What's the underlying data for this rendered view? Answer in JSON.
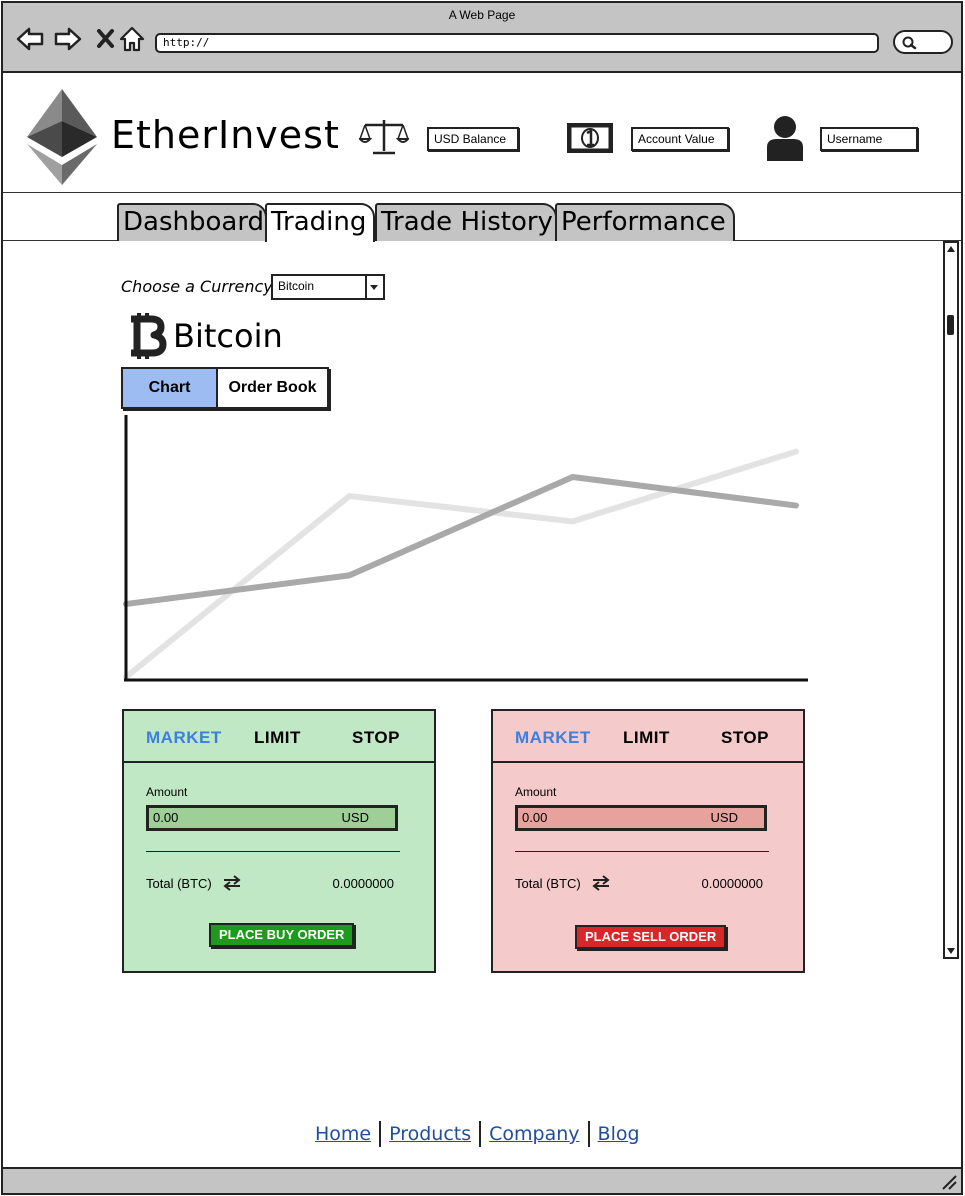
{
  "browser": {
    "title": "A Web Page",
    "url": "http://"
  },
  "header": {
    "brand": "EtherInvest",
    "usd_balance": "USD Balance",
    "account_value": "Account Value",
    "username": "Username"
  },
  "tabs": [
    {
      "label": "Dashboard"
    },
    {
      "label": "Trading"
    },
    {
      "label": "Trade History"
    },
    {
      "label": "Performance"
    }
  ],
  "currency": {
    "choose_label": "Choose a Currency",
    "selected": "Bitcoin",
    "title": "Bitcoin"
  },
  "view_toggle": {
    "chart": "Chart",
    "order_book": "Order Book",
    "active": "Chart"
  },
  "chart_data": {
    "type": "line",
    "x": [
      0,
      1,
      2,
      3
    ],
    "series": [
      {
        "values": [
          2.3,
          3.2,
          6.3,
          5.4
        ],
        "color": "#a9a9a9"
      },
      {
        "values": [
          0.0,
          5.7,
          4.9,
          7.1
        ],
        "color": "#e3e3e3"
      }
    ],
    "ylim": [
      0,
      8
    ],
    "title": "",
    "xlabel": "",
    "ylabel": ""
  },
  "buy_panel": {
    "tabs": [
      "MARKET",
      "LIMIT",
      "STOP"
    ],
    "active_tab": "MARKET",
    "amount_label": "Amount",
    "amount_value": "0.00",
    "amount_unit": "USD",
    "total_label": "Total (BTC)",
    "total_value": "0.0000000",
    "button": "PLACE BUY ORDER"
  },
  "sell_panel": {
    "tabs": [
      "MARKET",
      "LIMIT",
      "STOP"
    ],
    "active_tab": "MARKET",
    "amount_label": "Amount",
    "amount_value": "0.00",
    "amount_unit": "USD",
    "total_label": "Total (BTC)",
    "total_value": "0.0000000",
    "button": "PLACE SELL ORDER"
  },
  "footer": {
    "links": [
      "Home",
      "Products",
      "Company",
      "Blog"
    ]
  },
  "colors": {
    "buy_panel_bg": "#c0e8c4",
    "sell_panel_bg": "#f4caca",
    "buy_button": "#1e9a1e",
    "sell_button": "#d9262a",
    "active_tab_text": "#3d7fe0",
    "chart_toggle_active": "#9dbdf2",
    "link": "#1f4e9c"
  },
  "icons": {
    "back": "arrow-left-icon",
    "forward": "arrow-right-icon",
    "stop": "close-icon",
    "home": "home-icon",
    "search": "search-icon",
    "logo": "ethereum-logo",
    "balance": "scales-icon",
    "account_value": "banknote-icon",
    "user": "user-icon",
    "currency": "bitcoin-icon",
    "swap": "swap-arrows-icon"
  }
}
